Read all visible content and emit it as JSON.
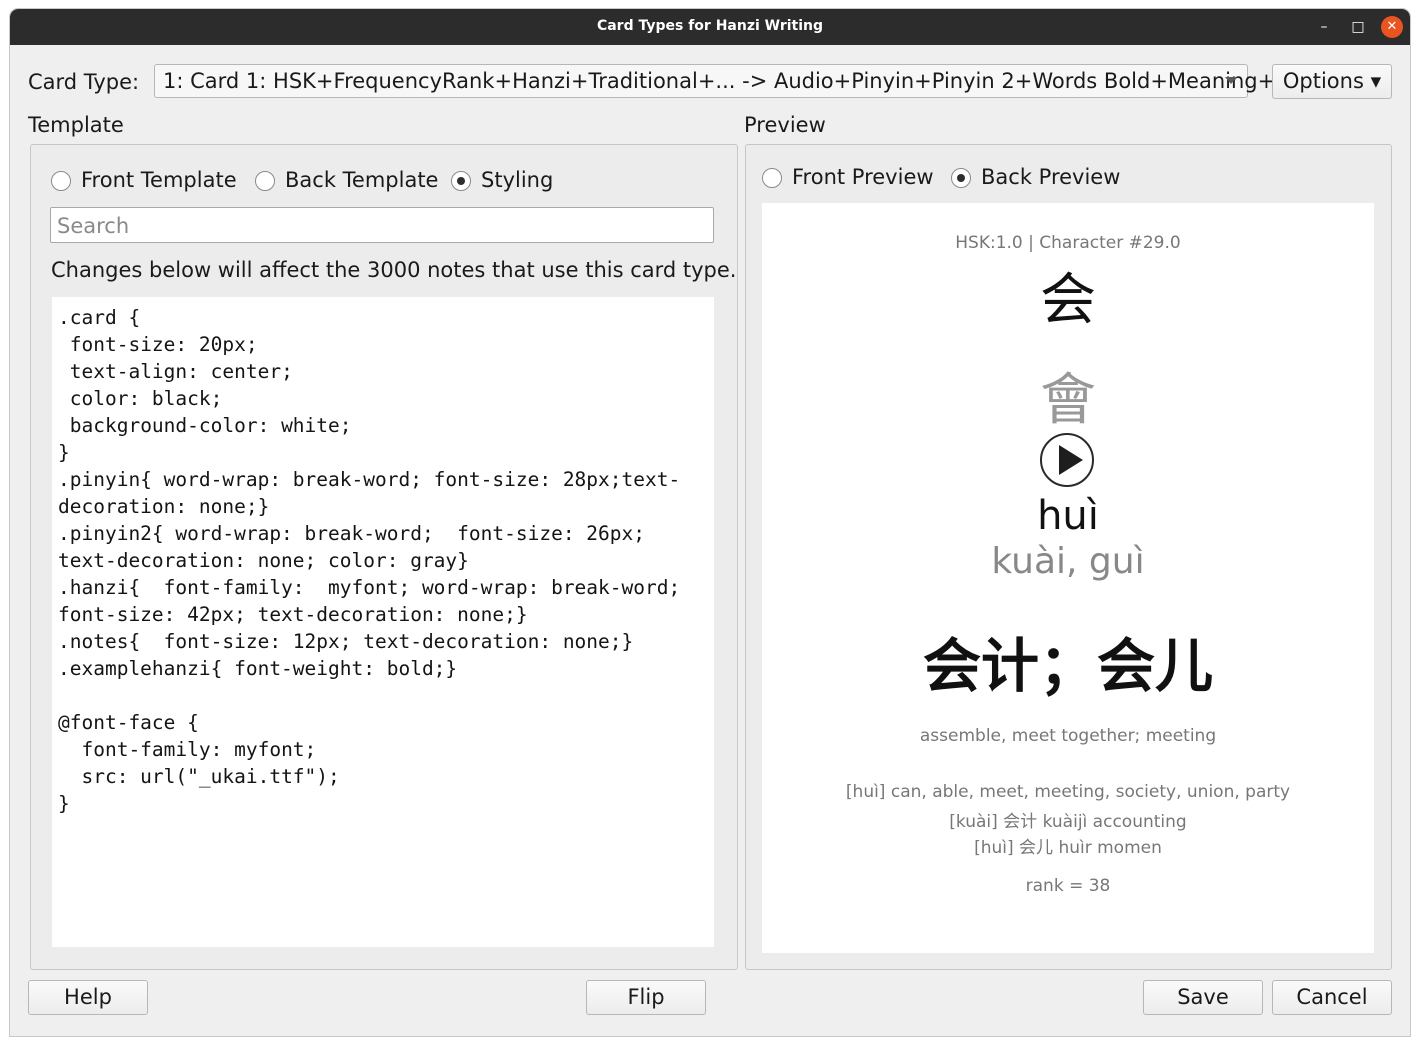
{
  "window": {
    "title": "Card Types for Hanzi Writing",
    "controls": {
      "minimize": "–",
      "maximize": "□",
      "close": "✕"
    }
  },
  "card_type": {
    "label": "Card Type:",
    "selected": "1: Card 1: HSK+FrequencyRank+Hanzi+Traditional+... -> Audio+Pinyin+Pinyin 2+Words Bold+Meaning+...",
    "options_button": "Options ▾"
  },
  "template": {
    "section_label": "Template",
    "radios": [
      {
        "label": "Front Template",
        "checked": false
      },
      {
        "label": "Back Template",
        "checked": false
      },
      {
        "label": "Styling",
        "checked": true
      }
    ],
    "search_placeholder": "Search",
    "notice": "Changes below will affect the 3000 notes that use this card type.",
    "code": ".card {\n font-size: 20px;\n text-align: center;\n color: black;\n background-color: white;\n}\n.pinyin{ word-wrap: break-word; font-size: 28px;text-decoration: none;}\n.pinyin2{ word-wrap: break-word;  font-size: 26px; text-decoration: none; color: gray}\n.hanzi{  font-family:  myfont; word-wrap: break-word; font-size: 42px; text-decoration: none;}\n.notes{  font-size: 12px; text-decoration: none;}\n.examplehanzi{ font-weight: bold;}\n\n@font-face {\n  font-family: myfont;\n  src: url(\"_ukai.ttf\");\n}"
  },
  "preview": {
    "section_label": "Preview",
    "radios": [
      {
        "label": "Front Preview",
        "checked": false
      },
      {
        "label": "Back Preview",
        "checked": true
      }
    ],
    "card": {
      "header": "HSK:1.0 | Character #29.0",
      "hanzi": "会",
      "traditional": "會",
      "pinyin": "huì",
      "pinyin2": "kuài, guì",
      "words": "会计；会儿",
      "meaning": "assemble, meet together; meeting",
      "notes": [
        "[huì] can, able, meet, meeting, society, union, party",
        "[kuài] 会计 kuàijì accounting",
        "[huì] 会儿 huìr momen"
      ],
      "rank": "rank = 38"
    }
  },
  "footer": {
    "help": "Help",
    "flip": "Flip",
    "save": "Save",
    "cancel": "Cancel"
  }
}
